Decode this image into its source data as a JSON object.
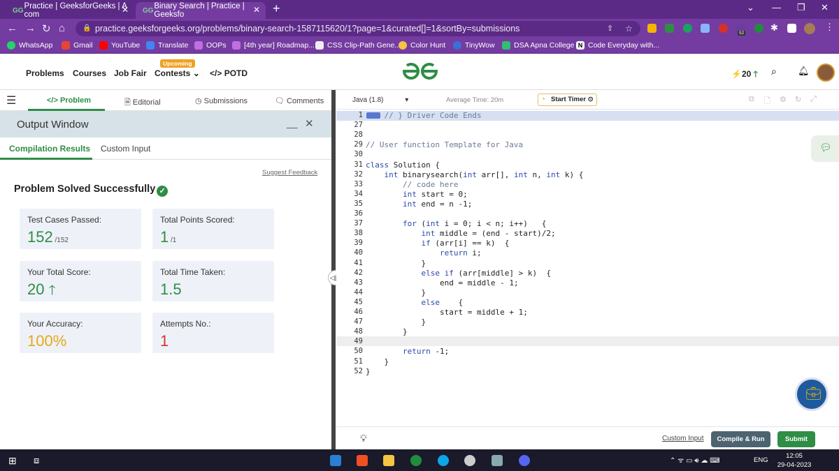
{
  "browser": {
    "tabs": [
      {
        "label": "Practice | GeeksforGeeks | A com",
        "favicon": "GG"
      },
      {
        "label": "Binary Search | Practice | Geeksfo",
        "favicon": "GG"
      }
    ],
    "new_tab": "+",
    "url": "practice.geeksforgeeks.org/problems/binary-search-1587115620/1?page=1&curated[]=1&sortBy=submissions",
    "ext_badge": "52",
    "bookmarks": [
      "WhatsApp",
      "Gmail",
      "YouTube",
      "Translate",
      "OOPs",
      "[4th year] Roadmap...",
      "CSS Clip-Path Gene...",
      "Color Hunt",
      "TinyWow",
      "DSA Apna College",
      "Code Everyday with..."
    ]
  },
  "header": {
    "nav": [
      "Problems",
      "Courses",
      "Job Fair",
      "Contests",
      "POTD"
    ],
    "upcoming": "Upcoming",
    "potd_icon": "</>",
    "streak": "20"
  },
  "left": {
    "tabs": [
      "Problem",
      "Editorial",
      "Submissions",
      "Comments"
    ],
    "output_title": "Output Window",
    "comp_tabs": [
      "Compilation Results",
      "Custom Input"
    ],
    "feedback": "Suggest Feedback",
    "solved": "Problem Solved Successfully",
    "cards": [
      {
        "label": "Test Cases Passed:",
        "value": "152",
        "sub": " /152",
        "color": "#2f8d46"
      },
      {
        "label": "Total Points Scored:",
        "value": "1",
        "sub": " /1",
        "color": "#2f8d46"
      },
      {
        "label": "Your Total Score:",
        "value": "20",
        "sub": "",
        "color": "#2f8d46"
      },
      {
        "label": "Total Time Taken:",
        "value": "1.5",
        "sub": "",
        "color": "#2f8d46"
      },
      {
        "label": "Your Accuracy:",
        "value": "100%",
        "sub": "",
        "color": "#e6a817"
      },
      {
        "label": "Attempts No.:",
        "value": "1",
        "sub": "",
        "color": "#d9342b"
      }
    ]
  },
  "editor": {
    "language": "Java (1.8)",
    "avg_time": "Average Time: 20m",
    "timer": "Start Timer",
    "line_numbers": [
      "1",
      "27",
      "28",
      "29",
      "30",
      "31",
      "32",
      "33",
      "34",
      "35",
      "36",
      "37",
      "38",
      "39",
      "40",
      "41",
      "42",
      "43",
      "44",
      "45",
      "46",
      "47",
      "48",
      "49",
      "50",
      "51",
      "52"
    ],
    "lines": [
      "    // } Driver Code Ends",
      "",
      "",
      "// User function Template for Java",
      "",
      "class Solution {",
      "    int binarysearch(int arr[], int n, int k) {",
      "        // code here",
      "        int start = 0;",
      "        int end = n -1;",
      "",
      "        for (int i = 0; i < n; i++)   {",
      "            int middle = (end - start)/2;",
      "            if (arr[i] == k)  {",
      "                return i;",
      "            }",
      "            else if (arr[middle] > k)  {",
      "                end = middle - 1;",
      "            }",
      "            else    {",
      "                start = middle + 1;",
      "            }",
      "        }",
      "",
      "        return -1;",
      "    }",
      "}"
    ],
    "custom_input": "Custom Input",
    "compile": "Compile & Run",
    "submit": "Submit"
  },
  "taskbar": {
    "lang": "ENG",
    "time": "12:05",
    "date": "29-04-2023"
  }
}
